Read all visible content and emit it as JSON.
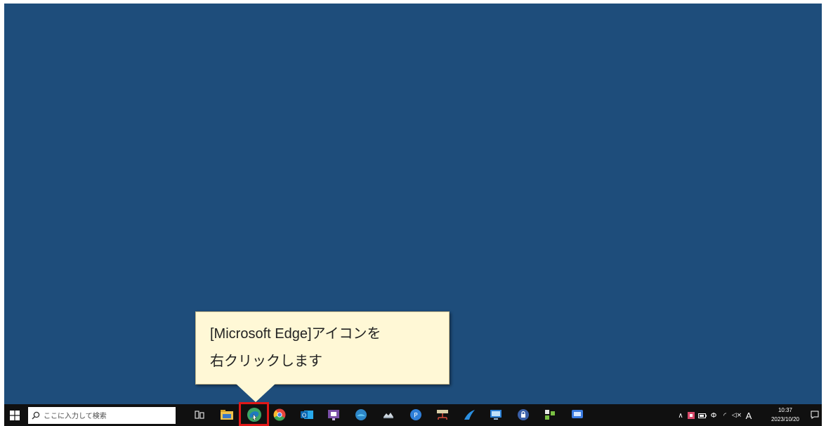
{
  "callout": {
    "line1": "[Microsoft Edge]アイコンを",
    "line2": "右クリックします"
  },
  "search": {
    "placeholder": "ここに入力して検索"
  },
  "clock": {
    "time": "10:37",
    "date": "2023/10/20"
  },
  "tray": {
    "ime": "A"
  },
  "colors": {
    "desktop": "#1e4d7b",
    "taskbar": "#101010",
    "highlight": "#e01818",
    "callout": "#fff8d6"
  },
  "taskbar_icons": [
    "windows-start-icon",
    "search-icon",
    "task-view-icon",
    "file-explorer-icon",
    "edge-icon",
    "chrome-icon",
    "outlook-icon",
    "teams-icon",
    "browser-icon",
    "cloud-icon",
    "app-p-icon",
    "network-icon",
    "app-swoosh-icon",
    "remote-desktop-icon",
    "lock-app-icon",
    "store-app-icon",
    "screen-app-icon"
  ]
}
